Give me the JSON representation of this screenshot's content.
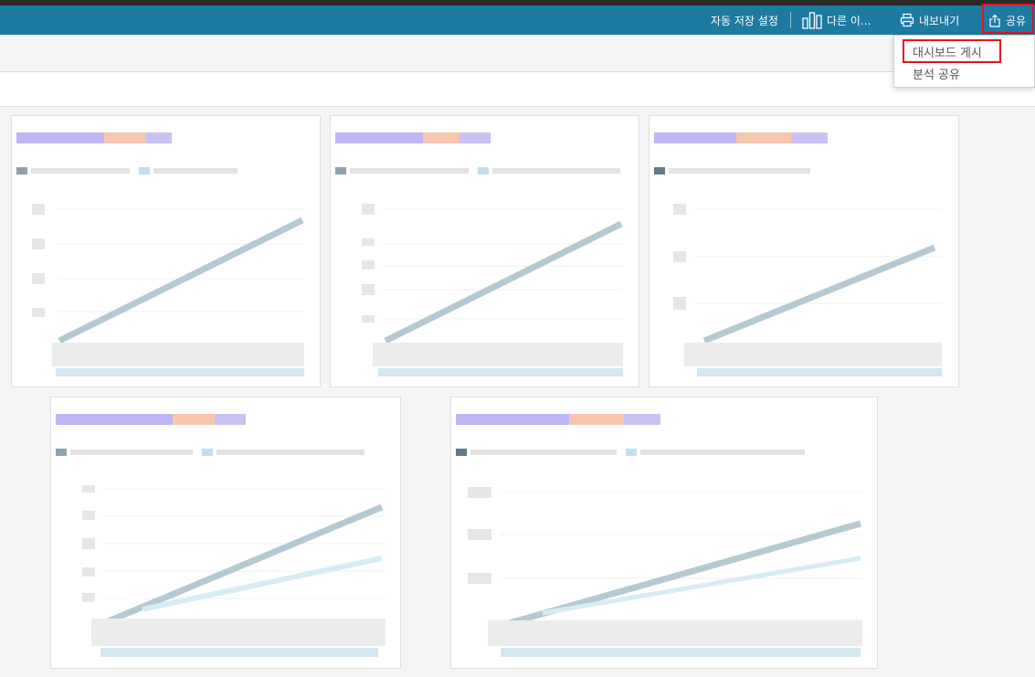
{
  "toolbar": {
    "autosave_label": "자동 저장 설정",
    "other_label": "다른 이...",
    "export_label": "내보내기",
    "share_label": "공유",
    "icons": [
      "bar-chart-icon",
      "printer-icon",
      "share-icon"
    ],
    "background": "#1d7aa1",
    "highlight_color": "#e81123"
  },
  "share_menu": {
    "items": [
      {
        "label": "대시보드 게시"
      },
      {
        "label": "분석 공유"
      }
    ]
  },
  "palette": {
    "title_purple": "#b9b2f2",
    "title_orange": "#f5c2a6",
    "series_dark": "#8ea2ad",
    "series_light": "#bfe0ec"
  }
}
